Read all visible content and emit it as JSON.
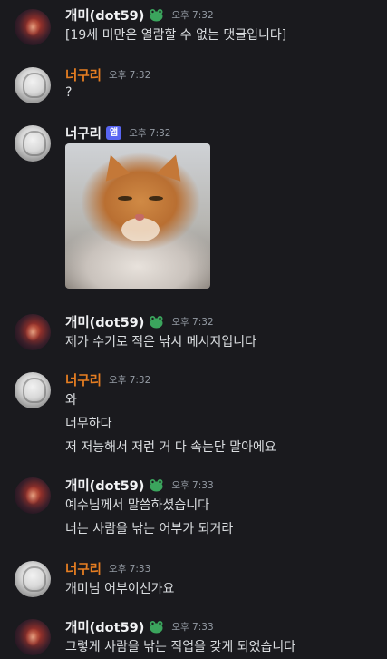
{
  "messages": [
    {
      "author": "개미(dot59)",
      "badge": "frog-badge",
      "time": "오후 7:32",
      "lines": [
        "[19세 미만은 열람할 수 없는 댓글입니다]"
      ]
    },
    {
      "author": "너구리",
      "time": "오후 7:32",
      "lines": [
        "?"
      ]
    },
    {
      "author": "너구리",
      "tag": "앱",
      "time": "오후 7:32",
      "image": "orange-tabby-cat-photo"
    },
    {
      "author": "개미(dot59)",
      "badge": "frog-badge",
      "time": "오후 7:32",
      "lines": [
        "제가 수기로 적은 낚시 메시지입니다"
      ]
    },
    {
      "author": "너구리",
      "time": "오후 7:32",
      "lines": [
        "와",
        "너무하다",
        "저 저능해서 저런 거 다 속는단 말아에요"
      ]
    },
    {
      "author": "개미(dot59)",
      "badge": "frog-badge",
      "time": "오후 7:33",
      "lines": [
        "예수님께서 말씀하셨습니다",
        "너는 사람을 낚는 어부가 되거라"
      ]
    },
    {
      "author": "너구리",
      "time": "오후 7:33",
      "lines": [
        "개미님 어부이신가요"
      ]
    },
    {
      "author": "개미(dot59)",
      "badge": "frog-badge",
      "time": "오후 7:33",
      "lines": [
        "그렇게 사람을 낚는 직업을 갖게 되었습니다"
      ]
    }
  ],
  "colors": {
    "background": "#1a1a1e",
    "username_default": "#f2f3f5",
    "username_neoguri": "#e67e22",
    "app_tag": "#5865f2",
    "badge_green": "#3ba55d"
  }
}
